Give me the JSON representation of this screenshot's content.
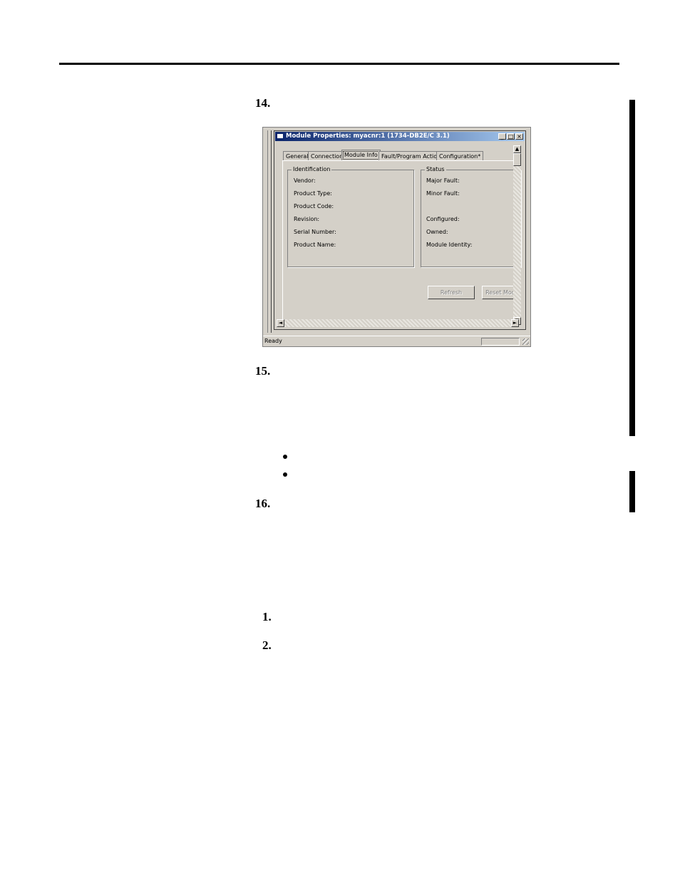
{
  "steps": {
    "s14": "14.",
    "s15": "15.",
    "s16": "16.",
    "s1": "1.",
    "s2": "2."
  },
  "screenshot": {
    "window_title": "Module Properties: myacnr:1 (1734-DB2E/C 3.1)",
    "title_buttons": {
      "minimize": "_",
      "maximize": "□",
      "close": "×"
    },
    "tabs": [
      "General",
      "Connection",
      "Module Info",
      "Fault/Program Action",
      "Configuration*"
    ],
    "active_tab": "Module Info",
    "identification": {
      "label": "Identification",
      "fields": [
        "Vendor:",
        "Product Type:",
        "Product Code:",
        "Revision:",
        "Serial Number:",
        "Product Name:"
      ]
    },
    "status_group": {
      "label": "Status",
      "fields": [
        "Major Fault:",
        "Minor Fault:",
        "Configured:",
        "Owned:",
        "Module Identity:"
      ]
    },
    "buttons": {
      "refresh": "Refresh",
      "reset": "Reset Mod"
    },
    "status_bar": "Ready",
    "scroll_glyphs": {
      "up": "▲",
      "down": "▼",
      "left": "◄",
      "right": "►"
    }
  }
}
